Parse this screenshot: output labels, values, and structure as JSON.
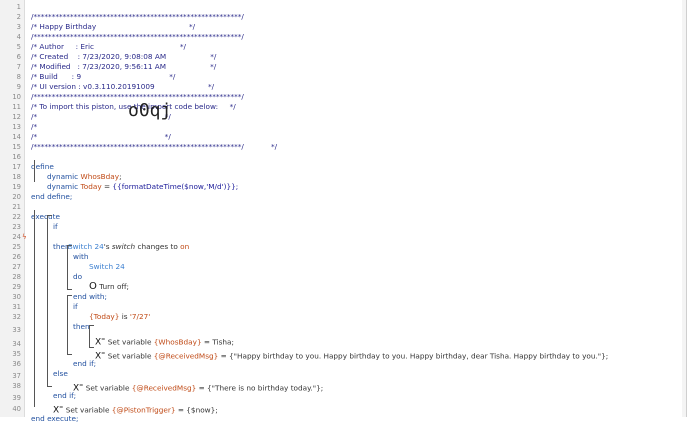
{
  "line_numbers": [
    "1",
    "2",
    "3",
    "4",
    "5",
    "6",
    "7",
    "8",
    "9",
    "10",
    "11",
    "12",
    "13",
    "14",
    "15",
    "16",
    "17",
    "18",
    "19",
    "20",
    "21",
    "22",
    "23",
    "24",
    "25",
    "26",
    "27",
    "28",
    "29",
    "30",
    "31",
    "32",
    "33",
    "34",
    "35",
    "36",
    "37",
    "38",
    "39",
    "40"
  ],
  "header": {
    "border": "/*********************************************************/",
    "title": "/* Happy Birthday                                        */",
    "author": "/* Author     : Eric                                     */",
    "created": "/* Created    : 7/23/2020, 9:08:08 AM                   */",
    "modified": "/* Modified   : 7/23/2020, 9:56:11 AM                   */",
    "build": "/* Build      : 9                                      */",
    "ui_version": "/* UI version : v0.3.110.20191009                       */",
    "import_note": "/* To import this piston, use the import code below:     */",
    "blank": "/*                                                       */",
    "code_prefix": "/*",
    "import_code": "o0qj",
    "code_suffix": "*/"
  },
  "define": {
    "kw_define": "define",
    "kw_dynamic": "dynamic",
    "var_whosbday": "WhosBday",
    "semicolon": ";",
    "var_today": "Today",
    "equals": " = ",
    "today_expr": "{{formatDateTime($now,'M/d')}};",
    "end_define": "end define;"
  },
  "execute": {
    "kw_execute": "execute",
    "kw_if": "if",
    "trigger_icon": "ϟ",
    "device_switch": "Switch 24",
    "switch_mid": "'s ",
    "switch_attr": "switch",
    "changes_to": " changes to ",
    "on_val": "on",
    "kw_then": "then",
    "kw_with": "with",
    "kw_do": "do",
    "turn_icon": "O",
    "turn_off": " Turn off;",
    "end_with": "end with;",
    "today_ref": "{Today}",
    "is_word": " is ",
    "date_val": "'7/27'",
    "x_icon": "X",
    "x_sup": "=",
    "set_variable": " Set variable ",
    "var_whosbday_ref": "{WhosBday}",
    "tisha_assign": " = Tisha;",
    "var_receivedmsg": "{@ReceivedMsg}",
    "msg_birthday": " = {\"Happy birthday to you. Happy birthday to you. Happy birthday, dear Tisha. Happy birthday to you.\"};",
    "end_if": "end if;",
    "kw_else": "else",
    "msg_none": " = {\"There is no birthday today.\"};",
    "var_pistontrigger": "{@PistonTrigger}",
    "now_assign": " = {$now};",
    "end_execute": "end execute;"
  }
}
